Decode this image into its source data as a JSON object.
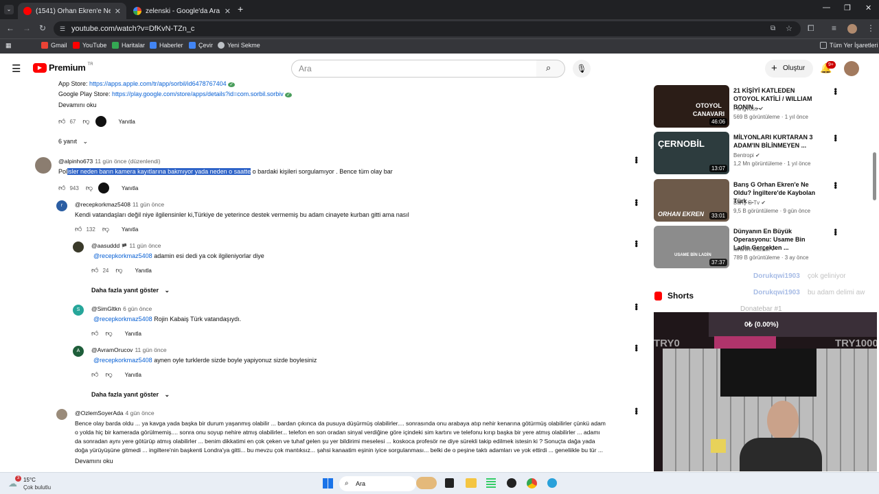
{
  "tabs": [
    {
      "title": "(1541) Orhan Ekren'e Ne Oldu?",
      "active": true
    },
    {
      "title": "zelenski - Google'da Ara",
      "active": false
    }
  ],
  "browser": {
    "url": "youtube.com/watch?v=DfKvN-TZn_c",
    "bookmarks": [
      "Gmail",
      "YouTube",
      "Haritalar",
      "Haberler",
      "Çevir",
      "Yeni Sekme"
    ],
    "all_bookmarks": "Tüm Yer İşaretleri"
  },
  "yt": {
    "logo": "Premium",
    "logo_sup": "TR",
    "search_placeholder": "Ara",
    "create_label": "Oluştur",
    "notif_count": "9+"
  },
  "top_comment": {
    "app_store_label": "App Store: ",
    "app_store_link": "https://apps.apple.com/tr/app/sorbil/id6478767404",
    "play_label": "Google Play Store: ",
    "play_link": "https://play.google.com/store/apps/details?id=com.sorbil.sorbiv",
    "read_more": "Devamını oku",
    "likes": "67",
    "reply": "Yanıtla",
    "replies": "6 yanıt"
  },
  "comments": [
    {
      "handle": "@alpinho673",
      "time": "11 gün önce (düzenlendi)",
      "text_pre": "Pol",
      "text_sel": "isler neden barın kamera kayıtlarına bakmıyor yada neden o saatte",
      "text_post": " o bardaki kişileri sorgulamıyor . Bence tüm olay bar",
      "likes": "943",
      "reply": "Yanıtla"
    },
    {
      "handle": "@recepkorkmaz5408",
      "time": "11 gün önce",
      "text": "Kendi vatandaşları değil niye ilgilensinler ki,Türkiye de yeterince destek vermemiş bu adam cinayete kurban gitti ama nasıl",
      "likes": "132",
      "reply": "Yanıtla"
    },
    {
      "handle": "@aasuddd",
      "time": "11 gün önce",
      "mention": "@recepkorkmaz5408",
      "text": " adamin esi dedi ya cok ilgileniyorlar diye",
      "likes": "24",
      "reply": "Yanıtla"
    },
    {
      "handle": "@SimGltkn",
      "time": "6 gün önce",
      "mention": "@recepkorkmaz5408",
      "text": "  Rojin Kabaiş Türk vatandaşıydı.",
      "reply": "Yanıtla"
    },
    {
      "handle": "@AvramOrucov",
      "time": "11 gün önce",
      "mention": "@recepkorkmaz5408",
      "text": " aynen oyle turklerde sizde boyle yapiyonuz sizde boylesiniz",
      "reply": "Yanıtla"
    },
    {
      "handle": "@OzlemSoyerAda",
      "time": "4 gün önce",
      "lines": [
        "Bence olay barda oldu ... ya kavga yada başka bir durum yaşanmış olabilir ... bardan çıkınca da pusuya düşürmüş olabilirler.... sonrasında onu arabaya atıp nehir kenarına götürmüş olabilirler çünkü adam",
        "o yolda hiç bir kamerada görülmemiş.... sonra onu soyup nehire atmış olabilirler... telefon en son oradan sinyal verdiğine göre içindeki sim kartını ve telefonu kırıp başka bir yere atmış olabilirler ... adamı",
        "da sonradan aynı yere götürüp atmış olabilirler ... benim dikkatimi en çok çeken ve tuhaf gelen şu yer bildirimi meselesi ... koskoca profesör ne diye sürekli takip edilmek istesin ki ? Sonuçta dağa yada",
        "doğa yürüyüşüne gitmedi ... ingiltere'nin başkenti Londra'ya gitti... bu mevzu çok mantıksız... şahsi kanaatim eşinin iyice sorgulanması... belki de o peşine taktı adamları ve yok ettirdi ... geneliikle bu tür ..."
      ],
      "read_more": "Devamını oku"
    }
  ],
  "show_more_replies": "Daha fazla yanıt göster",
  "videos": [
    {
      "title": "21 KİŞİYİ KATLEDEN OTOYOL KATİLİ / WILLIAM BONIN ...",
      "channel": "Pangvoss",
      "meta": "569 B görüntüleme · 1 yıl önce",
      "duration": "46:06",
      "thumb_text": "OTOYOL CANAVARI",
      "thumb_bg": "#2b1d17"
    },
    {
      "title": "MİLYONLARI KURTARAN 3 ADAM'IN BİLİNMEYEN ...",
      "channel": "Bentropi",
      "meta": "1,2 Mn görüntüleme · 1 yıl önce",
      "duration": "13:07",
      "thumb_text": "ÇERNOBİL",
      "thumb_bg": "#2d3c3e"
    },
    {
      "title": "Barış G Orhan Ekren'e Ne Oldu? İngiltere'de Kaybolan Türk ...",
      "channel": "Barış G Tv",
      "meta": "9,5 B görüntüleme · 9 gün önce",
      "duration": "33:01",
      "thumb_text": "ORHAN EKREN",
      "thumb_bg": "#6d5a4a"
    },
    {
      "title": "Dünyanın En Büyük Operasyonu: Usame Bin Ladin Gerçekten ...",
      "channel": "İbrahim Balsak",
      "meta": "789 B görüntüleme · 3 ay önce",
      "duration": "37:37",
      "thumb_text": "USAME BİN LADİN",
      "thumb_bg": "#8c8c8c"
    }
  ],
  "shorts_label": "Shorts",
  "overlay": {
    "users": [
      "Dorukqwi1903",
      "Dorukqwi1903"
    ],
    "msgs": [
      "çok geliniyor",
      "bu adam delimi aw"
    ],
    "donate": "Donatebar #1",
    "donate_amount": "0₺ (0.00%)",
    "tryo": "TRY0",
    "try1000": "TRY1000"
  },
  "taskbar": {
    "temp": "15°C",
    "weather": "Çok bulutlu",
    "search": "Ara",
    "badge": "3"
  }
}
